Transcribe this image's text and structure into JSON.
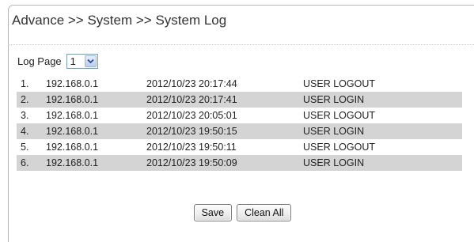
{
  "breadcrumb": "Advance >> System >> System Log",
  "log_page": {
    "label": "Log Page",
    "selected": "1"
  },
  "rows": [
    {
      "num": "1.",
      "ip": "192.168.0.1",
      "time": "2012/10/23 20:17:44",
      "event": "USER LOGOUT"
    },
    {
      "num": "2.",
      "ip": "192.168.0.1",
      "time": "2012/10/23 20:17:41",
      "event": "USER LOGIN"
    },
    {
      "num": "3.",
      "ip": "192.168.0.1",
      "time": "2012/10/23 20:05:01",
      "event": "USER LOGOUT"
    },
    {
      "num": "4.",
      "ip": "192.168.0.1",
      "time": "2012/10/23 19:50:15",
      "event": "USER LOGIN"
    },
    {
      "num": "5.",
      "ip": "192.168.0.1",
      "time": "2012/10/23 19:50:11",
      "event": "USER LOGOUT"
    },
    {
      "num": "6.",
      "ip": "192.168.0.1",
      "time": "2012/10/23 19:50:09",
      "event": "USER LOGIN"
    }
  ],
  "buttons": {
    "save": "Save",
    "clean_all": "Clean All"
  },
  "colors": {
    "alt_row": "#d4d4d4",
    "panel_border": "#b5b5b5"
  }
}
